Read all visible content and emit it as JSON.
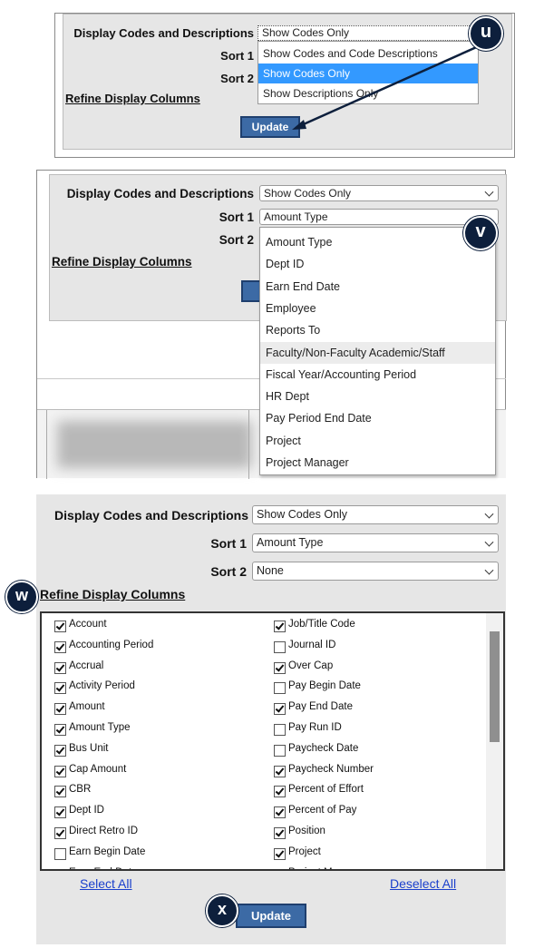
{
  "panel_u": {
    "display_label": "Display Codes and Descriptions",
    "sort1_label": "Sort 1",
    "sort2_label": "Sort 2",
    "refine_label": "Refine Display Columns",
    "select_value": "Show Codes Only",
    "options": [
      "Show Codes and Code Descriptions",
      "Show Codes Only",
      "Show Descriptions Only"
    ],
    "highlighted_option": "Show Codes Only",
    "update_label": "Update",
    "callout": "u"
  },
  "panel_v": {
    "display_label": "Display Codes and Descriptions",
    "display_value": "Show Codes Only",
    "sort1_label": "Sort 1",
    "sort1_value": "Amount Type",
    "sort2_label": "Sort 2",
    "refine_label": "Refine Display Columns",
    "options": [
      "Amount Type",
      "Dept ID",
      "Earn End Date",
      "Employee",
      "Reports To",
      "Faculty/Non-Faculty Academic/Staff",
      "Fiscal Year/Accounting Period",
      "HR Dept",
      "Pay Period End Date",
      "Project",
      "Project Manager"
    ],
    "hovered_option": "Faculty/Non-Faculty Academic/Staff",
    "callout": "v"
  },
  "panel_w": {
    "display_label": "Display Codes and Descriptions",
    "display_value": "Show Codes Only",
    "sort1_label": "Sort 1",
    "sort1_value": "Amount Type",
    "sort2_label": "Sort 2",
    "sort2_value": "None",
    "refine_label": "Refine Display Columns",
    "callout_w": "w",
    "callout_x": "x",
    "left_columns": [
      {
        "label": "Account",
        "checked": true
      },
      {
        "label": "Accounting Period",
        "checked": true
      },
      {
        "label": "Accrual",
        "checked": true
      },
      {
        "label": "Activity Period",
        "checked": true
      },
      {
        "label": "Amount",
        "checked": true
      },
      {
        "label": "Amount Type",
        "checked": true
      },
      {
        "label": "Bus Unit",
        "checked": true
      },
      {
        "label": "Cap Amount",
        "checked": true
      },
      {
        "label": "CBR",
        "checked": true
      },
      {
        "label": "Dept ID",
        "checked": true
      },
      {
        "label": "Direct Retro ID",
        "checked": true
      },
      {
        "label": "Earn Begin Date",
        "checked": false
      },
      {
        "label": "Earn End Date",
        "checked": true
      }
    ],
    "right_columns": [
      {
        "label": "Job/Title Code",
        "checked": true
      },
      {
        "label": "Journal ID",
        "checked": false
      },
      {
        "label": "Over Cap",
        "checked": true
      },
      {
        "label": "Pay Begin Date",
        "checked": false
      },
      {
        "label": "Pay End Date",
        "checked": true
      },
      {
        "label": "Pay Run ID",
        "checked": false
      },
      {
        "label": "Paycheck Date",
        "checked": false
      },
      {
        "label": "Paycheck Number",
        "checked": true
      },
      {
        "label": "Percent of Effort",
        "checked": true
      },
      {
        "label": "Percent of Pay",
        "checked": true
      },
      {
        "label": "Position",
        "checked": true
      },
      {
        "label": "Project",
        "checked": true
      },
      {
        "label": "Project Manager",
        "checked": false
      }
    ],
    "select_all_label": "Select All",
    "deselect_all_label": "Deselect All",
    "update_label": "Update"
  },
  "colors": {
    "panel_bg": "#e6e6e6",
    "highlight_blue": "#3399ff",
    "button_blue": "#3c6aa5",
    "callout_navy": "#0d1f3c",
    "link_blue": "#1a3fcc"
  }
}
